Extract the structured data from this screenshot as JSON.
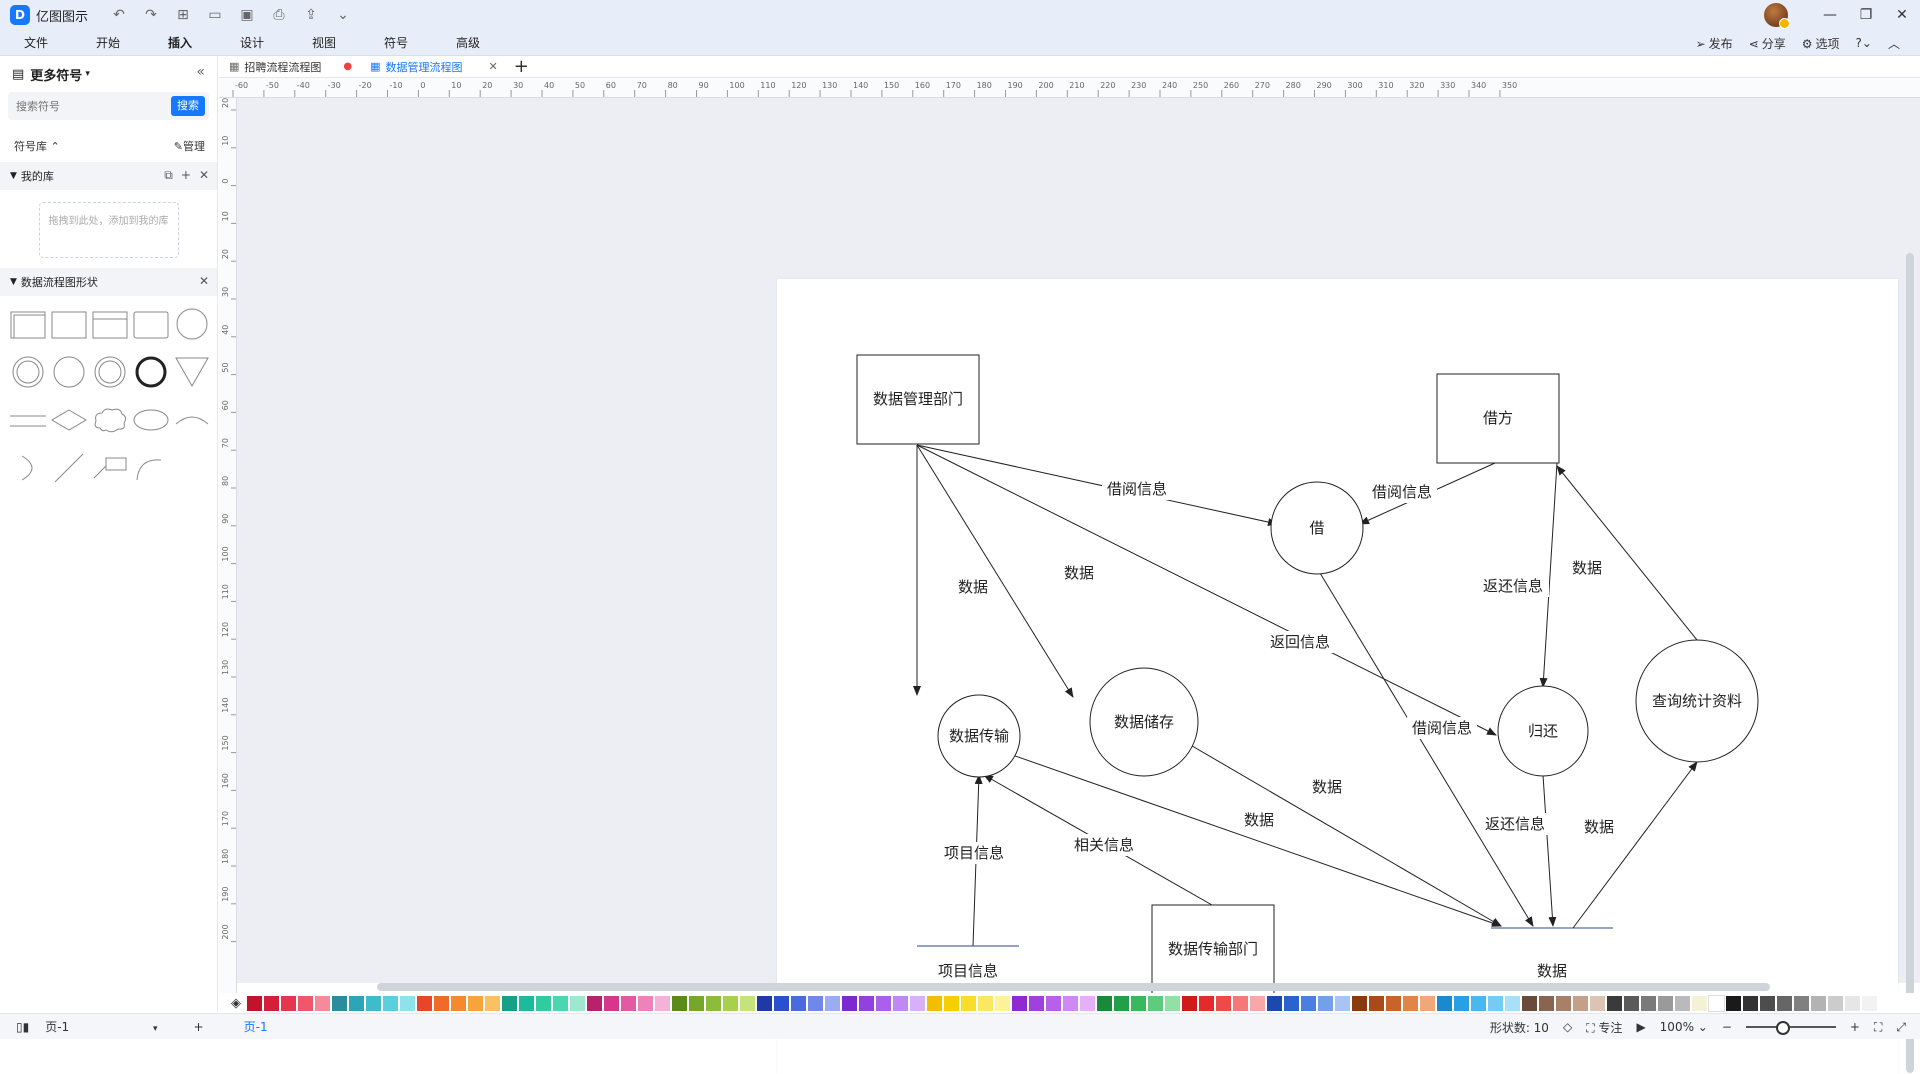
{
  "app": {
    "name": "亿图图示",
    "logo_letter": "D"
  },
  "menu": {
    "items": [
      "文件",
      "开始",
      "插入",
      "设计",
      "视图",
      "符号",
      "高级"
    ],
    "active": "插入",
    "right": {
      "publish": "发布",
      "share": "分享",
      "options": "选项"
    }
  },
  "left_panel": {
    "title": "更多符号",
    "search_placeholder": "搜索符号",
    "search_button": "搜索",
    "library_label": "符号库",
    "manage_label": "管理",
    "my_library": "我的库",
    "dropzone_text": "拖拽到此处，添加到我的库",
    "dfd_section": "数据流程图形状"
  },
  "tabs": [
    {
      "label": "招聘流程流程图",
      "modified": true
    },
    {
      "label": "数据管理流程图",
      "active": true
    }
  ],
  "ruler": {
    "h_ticks": [
      "-60",
      "-50",
      "-40",
      "-30",
      "-20",
      "-10",
      "0",
      "10",
      "20",
      "30",
      "40",
      "50",
      "60",
      "70",
      "80",
      "90",
      "100",
      "110",
      "120",
      "130",
      "140",
      "150",
      "160",
      "170",
      "180",
      "190",
      "200",
      "210",
      "220",
      "230",
      "240",
      "250",
      "260",
      "270",
      "280",
      "290",
      "300",
      "310",
      "320",
      "330",
      "340",
      "350"
    ],
    "v_ticks": [
      "20",
      "10",
      "0",
      "10",
      "20",
      "30",
      "40",
      "50",
      "60",
      "70",
      "80",
      "90",
      "100",
      "110",
      "120",
      "130",
      "140",
      "150",
      "160",
      "170",
      "180",
      "190",
      "200"
    ]
  },
  "diagram": {
    "entities": {
      "data_mgmt_dept": "数据管理部门",
      "borrower": "借方",
      "data_transfer_dept": "数据传输部门"
    },
    "processes": {
      "borrow": "借",
      "return": "归还",
      "data_transfer": "数据传输",
      "data_storage": "数据储存",
      "query_stats": "查询统计资料"
    },
    "stores": {
      "project_info": "项目信息",
      "data_store": "数据"
    },
    "labels": {
      "borrow_info_1": "借阅信息",
      "borrow_info_2": "借阅信息",
      "borrow_info_3": "借阅信息",
      "data_1": "数据",
      "data_2": "数据",
      "data_3": "数据",
      "data_4": "数据",
      "data_5": "数据",
      "data_6": "数据",
      "return_msg": "返回信息",
      "return_info_1": "返还信息",
      "return_info_2": "返还信息",
      "project_info_label": "项目信息",
      "related_info": "相关信息"
    }
  },
  "palette": {
    "colors": [
      "#c0142c",
      "#d41f3a",
      "#e4374f",
      "#f0566c",
      "#f78a9a",
      "#2a8c9c",
      "#2aa6b6",
      "#3fbccc",
      "#5ad0de",
      "#8ee2ec",
      "#e8462a",
      "#f06a2a",
      "#f5892e",
      "#f7a43a",
      "#f9c064",
      "#16a085",
      "#1abc9c",
      "#2ecc9e",
      "#48d8b0",
      "#9ee8d2",
      "#b8226a",
      "#d6378a",
      "#e45aa2",
      "#ee82bb",
      "#f6b2d6",
      "#5a8a1a",
      "#74a82a",
      "#8cbc3a",
      "#a8d04c",
      "#c6e27a",
      "#1f3aa6",
      "#2a4fd0",
      "#4a6ae0",
      "#7088ea",
      "#9cacf2",
      "#7a2ad0",
      "#9440e0",
      "#aa60ea",
      "#c088f2",
      "#d8b0f8",
      "#f0c000",
      "#f5d000",
      "#f8de2a",
      "#fae860",
      "#fcf298",
      "#8e2ad0",
      "#a040e0",
      "#b860ea",
      "#d088f2",
      "#e6b0f8",
      "#1a8a3a",
      "#22a048",
      "#3ab85e",
      "#5ecc7c",
      "#92e0a6",
      "#d01a1a",
      "#e42a2a",
      "#ee4a4a",
      "#f47878",
      "#f8a8a8",
      "#1a4ab0",
      "#2a62d0",
      "#4a7ee0",
      "#74a0ea",
      "#a8c4f4",
      "#8a3a10",
      "#a84a1a",
      "#c8642a",
      "#e0844a",
      "#f0a878",
      "#1a8ad0",
      "#2aa0e4",
      "#48b8ee",
      "#74ccf4",
      "#a8e0fa",
      "#6a4a3a",
      "#8a6450",
      "#a88068",
      "#c4a08a",
      "#dcc4b4",
      "#3a3a3a",
      "#5a5a5a",
      "#7a7a7a",
      "#9a9a9a",
      "#bababa",
      "#f5f0d8",
      "#ffffff",
      "#1a1a1a",
      "#333333",
      "#4d4d4d",
      "#666666",
      "#808080",
      "#b3b3b3",
      "#cccccc",
      "#e6e6e6",
      "#f2f2f2"
    ]
  },
  "status": {
    "page_label": "页-1",
    "active_page": "页-1",
    "shape_count": "形状数: 10",
    "focus": "专注",
    "zoom": "100%"
  }
}
